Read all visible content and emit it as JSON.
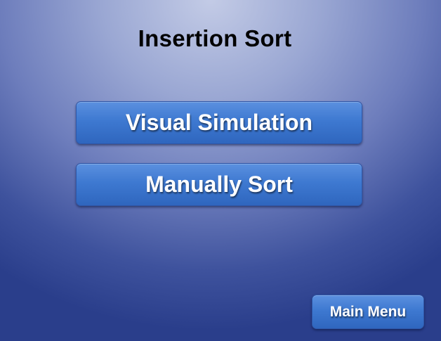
{
  "title": "Insertion Sort",
  "buttons": {
    "visual_simulation": "Visual Simulation",
    "manually_sort": "Manually Sort",
    "main_menu": "Main Menu"
  },
  "colors": {
    "background_center": "#c3cbe6",
    "background_edge": "#2a3e8b",
    "button_fill": "#3e79d1",
    "button_text": "#ffffff",
    "title_text": "#000000"
  }
}
